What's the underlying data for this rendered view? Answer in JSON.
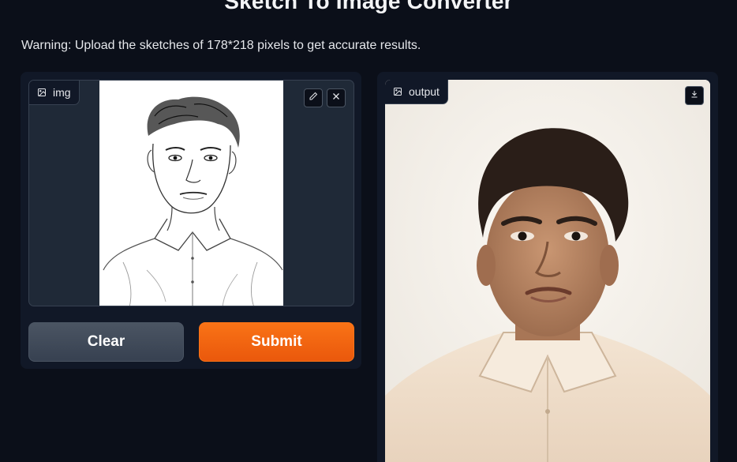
{
  "header": {
    "title": "Sketch To Image Converter",
    "warning": "Warning: Upload the sketches of 178*218 pixels to get accurate results."
  },
  "input_panel": {
    "label": "img",
    "label_icon": "image-icon",
    "tools": [
      "pencil-icon",
      "close-icon"
    ]
  },
  "buttons": {
    "clear_label": "Clear",
    "submit_label": "Submit"
  },
  "output_panel": {
    "label": "output",
    "label_icon": "image-icon",
    "download_icon": "download-icon"
  },
  "colors": {
    "background": "#0b0f19",
    "panel": "#111827",
    "submit": "#f97316",
    "clear": "#4b5563"
  }
}
